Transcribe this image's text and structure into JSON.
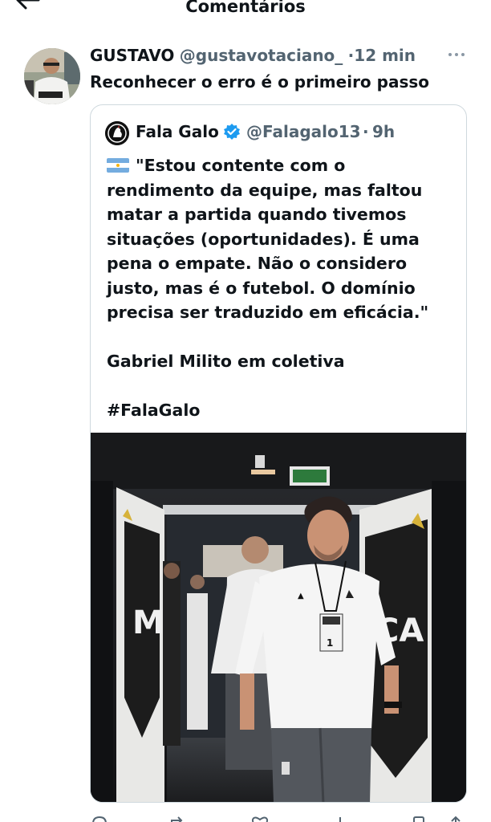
{
  "header": {
    "title": "Comentários"
  },
  "comment": {
    "author_name": "GUSTAVO",
    "author_handle": "@gustavotaciano_",
    "dot": "·",
    "time": "12 min",
    "text": "Reconhecer o erro é o primeiro passo",
    "avatar_icon": "user-avatar",
    "more_icon": "more-icon"
  },
  "quote": {
    "name": "Fala Galo",
    "handle": "@Falagalo13",
    "dot": "·",
    "time": "9h",
    "verified_icon": "verified-badge-icon",
    "flag_icon": "argentina-flag-icon",
    "lines": [
      "\"Estou contente com o",
      "rendimento da equipe, mas faltou",
      "matar a partida quando tivemos",
      "situações (oportunidades). É uma",
      "pena o empate. Não o considero",
      "justo, mas é o futebol. O domínio",
      "precisa ser traduzido em eficácia.\""
    ],
    "attribution": "Gabriel Milito em coletiva",
    "hashtag": "#FalaGalo",
    "photo_alt": "Gabriel Milito walking through the stadium tunnel"
  },
  "actions": {
    "icons": [
      "reply-icon",
      "retweet-icon",
      "like-icon",
      "views-icon",
      "bookmark-icon",
      "share-icon"
    ]
  }
}
